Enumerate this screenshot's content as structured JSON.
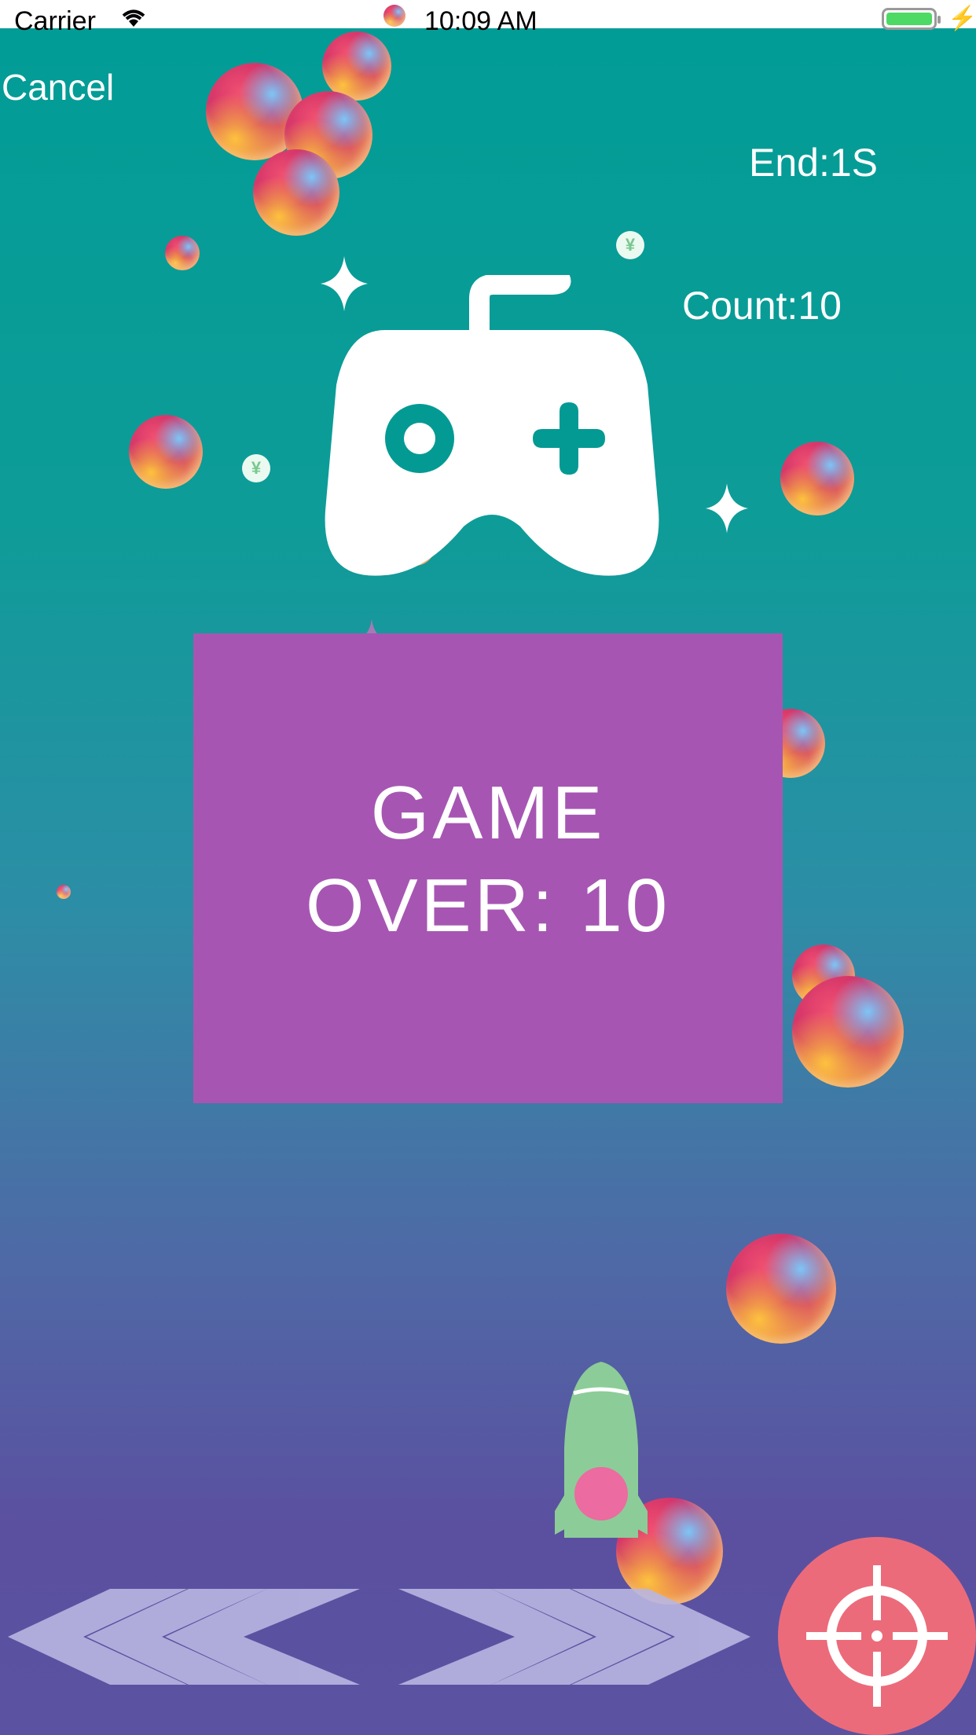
{
  "status_bar": {
    "carrier": "Carrier",
    "time": "10:09 AM",
    "wifi_icon": "wifi-icon",
    "battery_icon": "battery-icon",
    "charging_icon": "charging-bolt-icon"
  },
  "header": {
    "cancel_label": "Cancel",
    "end_label": "End:1S",
    "count_label": "Count:10"
  },
  "game_over": {
    "text": "GAME\nOVER: 10"
  },
  "icons": {
    "gamepad": "gamepad-icon",
    "rocket": "rocket-icon",
    "left_arrows": "left-chevrons-icon",
    "right_arrows": "right-chevrons-icon",
    "fire": "crosshair-icon",
    "coin": "yen-coin-icon",
    "coin_symbol": "¥"
  },
  "colors": {
    "background_top": "#019c96",
    "background_bottom": "#5b52a2",
    "game_over_panel": "#a656b2",
    "fire_button": "#ec6b7a",
    "rocket_body": "#8ccc98",
    "rocket_window": "#ec6ba0"
  }
}
